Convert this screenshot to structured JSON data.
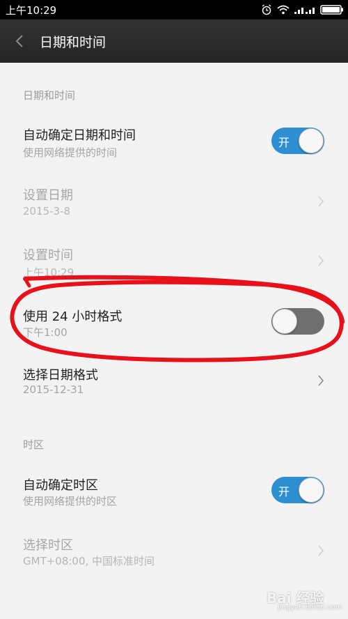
{
  "status_bar": {
    "time": "上午10:29",
    "icons": [
      "alarm-icon",
      "wifi-icon",
      "signal-icon",
      "battery-icon"
    ]
  },
  "header": {
    "title": "日期和时间",
    "back_icon": "chevron-left-icon"
  },
  "sections": {
    "date_time": {
      "header": "日期和时间"
    },
    "timezone": {
      "header": "时区"
    }
  },
  "rows": {
    "auto_datetime": {
      "title": "自动确定日期和时间",
      "subtitle": "使用网络提供的时间",
      "toggle_label": "开",
      "enabled": true
    },
    "set_date": {
      "title": "设置日期",
      "subtitle": "2015-3-8"
    },
    "set_time": {
      "title": "设置时间",
      "subtitle": "上午10:29"
    },
    "use_24h": {
      "title": "使用 24 小时格式",
      "subtitle": "下午1:00",
      "enabled": false
    },
    "date_format": {
      "title": "选择日期格式",
      "subtitle": "2015-12-31"
    },
    "auto_timezone": {
      "title": "自动确定时区",
      "subtitle": "使用网络提供的时区",
      "toggle_label": "开",
      "enabled": true
    },
    "select_timezone": {
      "title": "选择时区",
      "subtitle": "GMT+08:00, 中国标准时间"
    }
  },
  "watermark": {
    "text": "Bai 经验",
    "sub": "jingyan.baidu.com"
  },
  "colors": {
    "toggle_on": "#2d8fd1",
    "toggle_off": "#6f6f6f",
    "annotation": "#e8101a",
    "title_bar": "#2b2b2b"
  }
}
